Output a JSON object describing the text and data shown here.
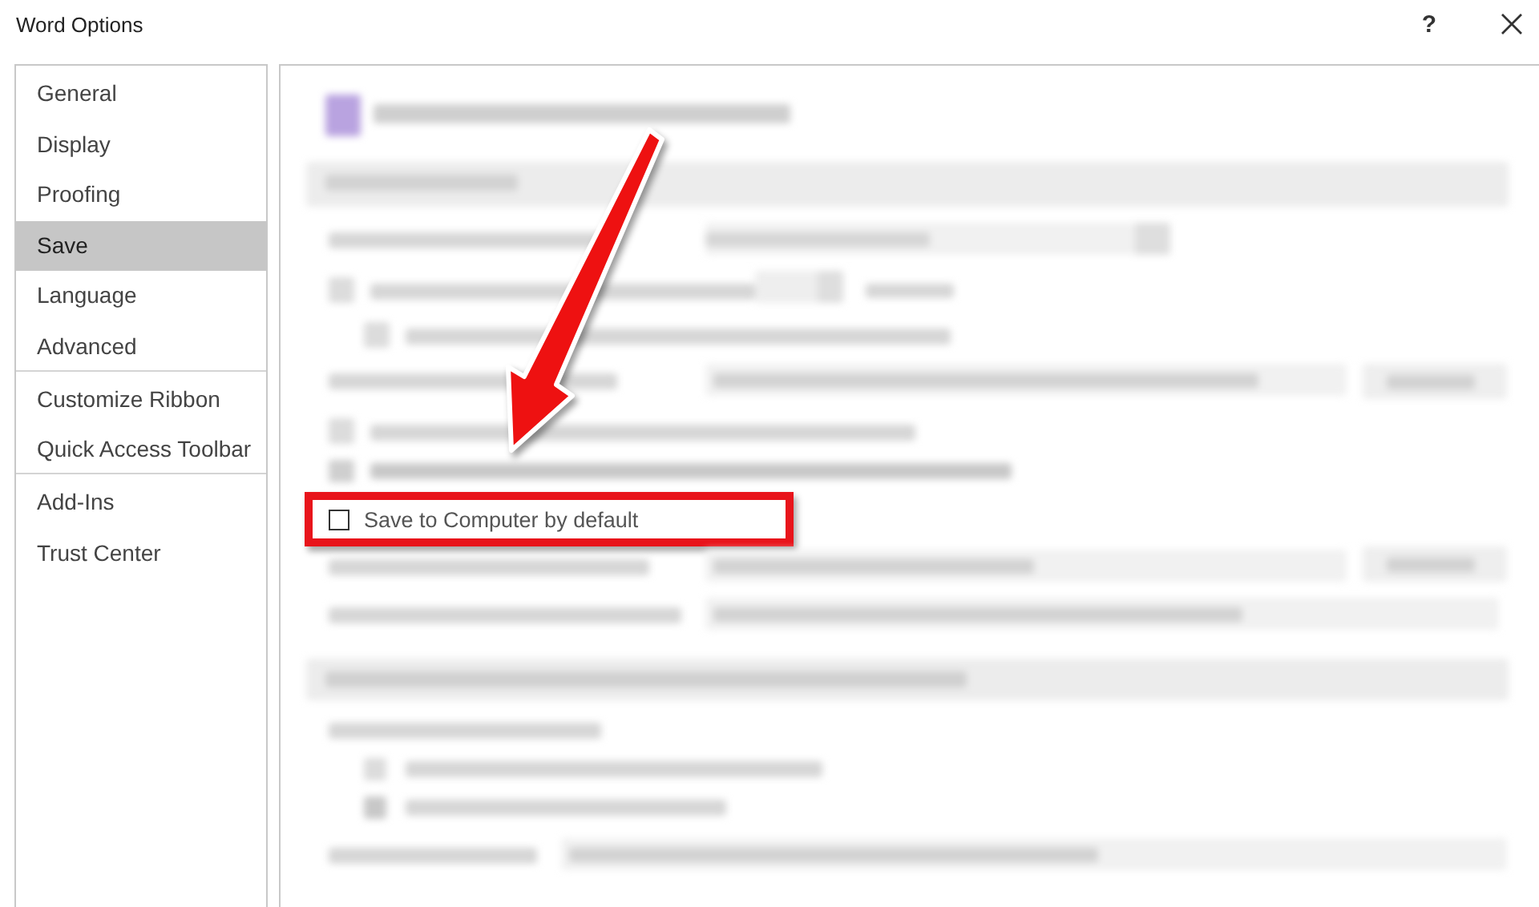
{
  "window": {
    "title": "Word Options",
    "help": "?"
  },
  "sidebar": {
    "items": [
      {
        "label": "General",
        "selected": false,
        "separator_after": false
      },
      {
        "label": "Display",
        "selected": false,
        "separator_after": false
      },
      {
        "label": "Proofing",
        "selected": false,
        "separator_after": false
      },
      {
        "label": "Save",
        "selected": true,
        "separator_after": false
      },
      {
        "label": "Language",
        "selected": false,
        "separator_after": false
      },
      {
        "label": "Advanced",
        "selected": false,
        "separator_after": true
      },
      {
        "label": "Customize Ribbon",
        "selected": false,
        "separator_after": false
      },
      {
        "label": "Quick Access Toolbar",
        "selected": false,
        "separator_after": true
      },
      {
        "label": "Add-Ins",
        "selected": false,
        "separator_after": false
      },
      {
        "label": "Trust Center",
        "selected": false,
        "separator_after": false
      }
    ]
  },
  "option": {
    "label": "Save to Computer by default",
    "checked": false,
    "highlighted": true
  }
}
